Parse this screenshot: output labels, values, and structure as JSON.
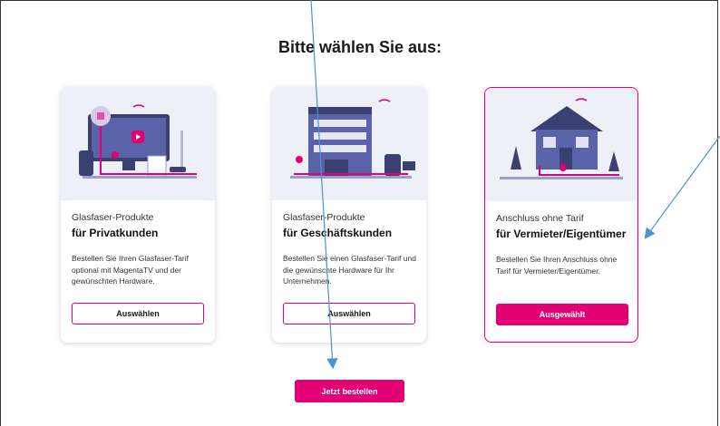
{
  "heading": "Bitte wählen Sie aus:",
  "cards": [
    {
      "subtitle": "Glasfaser-Produkte",
      "title": "für Privatkunden",
      "description": "Bestellen Sie Ihren Glasfaser-Tarif optional mit MagentaTV und der gewünschten Hardware.",
      "button": "Auswählen",
      "selected": false
    },
    {
      "subtitle": "Glasfaser-Produkte",
      "title": "für Geschäftskunden",
      "description": "Bestellen Sie einen Glasfaser-Tarif und die gewünschte Hardware für Ihr Unternehmen.",
      "button": "Auswählen",
      "selected": false
    },
    {
      "subtitle": "Anschluss ohne Tarif",
      "title": "für Vermieter/Eigentümer",
      "description": "Bestellen Sie Ihren Anschluss ohne Tarif für Vermieter/Eigentümer.",
      "button": "Ausgewählt",
      "selected": true
    }
  ],
  "order_button": "Jetzt bestellen",
  "colors": {
    "accent": "#e20074",
    "card_image_bg": "#eef0f8",
    "annotation_arrow": "#4a90d9"
  },
  "annotations": [
    "arrow-annotation",
    "arrow-annotation",
    "arrow-annotation"
  ]
}
